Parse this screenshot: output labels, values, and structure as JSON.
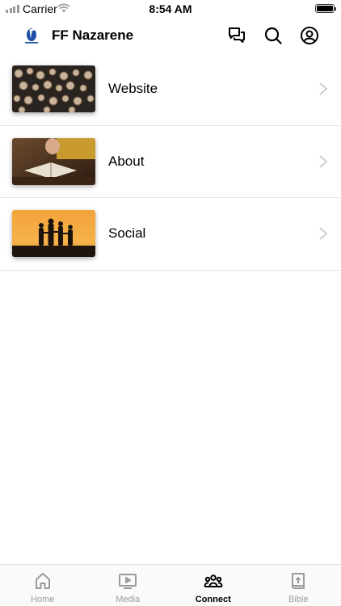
{
  "status_bar": {
    "carrier": "Carrier",
    "time": "8:54 AM"
  },
  "nav": {
    "title": "FF Nazarene",
    "icons": [
      "chat-icon",
      "search-icon",
      "profile-icon"
    ]
  },
  "menu": {
    "items": [
      {
        "label": "Website",
        "thumb": "stacked-logs-image"
      },
      {
        "label": "About",
        "thumb": "open-bible-image"
      },
      {
        "label": "Social",
        "thumb": "sunset-silhouettes-image"
      }
    ]
  },
  "tabs": {
    "items": [
      {
        "label": "Home",
        "icon": "home-icon",
        "active": false
      },
      {
        "label": "Media",
        "icon": "media-icon",
        "active": false
      },
      {
        "label": "Connect",
        "icon": "connect-icon",
        "active": true
      },
      {
        "label": "Bible",
        "icon": "bible-icon",
        "active": false
      }
    ]
  },
  "colors": {
    "accent": "#000000",
    "inactive_tab": "#9b9b9b",
    "logo_blue": "#1f4ea8"
  }
}
